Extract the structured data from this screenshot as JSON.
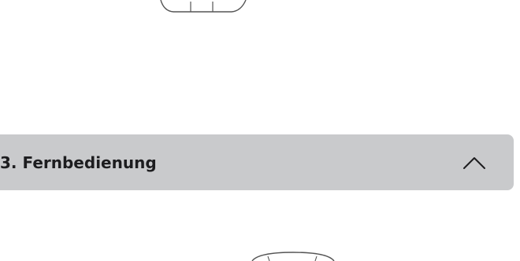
{
  "section": {
    "title": "3. Fernbedienung",
    "state": "expanded",
    "toggle_icon": "chevron-up-icon"
  },
  "illustrations": {
    "top": "device-outline-illustration",
    "bottom": "remote-outline-illustration"
  },
  "colors": {
    "header_background": "#c9cacc",
    "text": "#1d1d1f",
    "line": "#555555",
    "page_background": "#ffffff"
  }
}
